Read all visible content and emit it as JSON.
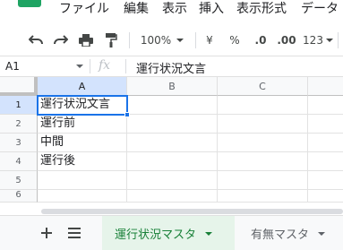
{
  "menu": {
    "items": [
      "ファイル",
      "編集",
      "表示",
      "挿入",
      "表示形式",
      "データ"
    ]
  },
  "toolbar": {
    "zoom": "100%",
    "currency": "¥",
    "percent": "%",
    "decimal_decrease": ".0",
    "decimal_increase": ".00",
    "number_format": "123"
  },
  "formula_bar": {
    "name_box": "A1",
    "fx_label": "fx",
    "value": "運行状況文言"
  },
  "grid": {
    "columns": [
      "A",
      "B",
      "C"
    ],
    "rows": [
      "1",
      "2",
      "3",
      "4",
      "5",
      "6"
    ],
    "cells": {
      "A1": "運行状況文言",
      "A2": "運行前",
      "A3": "中間",
      "A4": "運行後"
    },
    "selected_cell": "A1"
  },
  "sheets": {
    "tabs": [
      {
        "label": "運行状況マスタ",
        "active": true
      },
      {
        "label": "有無マスタ",
        "active": false
      }
    ]
  },
  "colors": {
    "accent_blue": "#1a73e8",
    "active_tab_green": "#188038",
    "logo_green": "#1fa463"
  }
}
